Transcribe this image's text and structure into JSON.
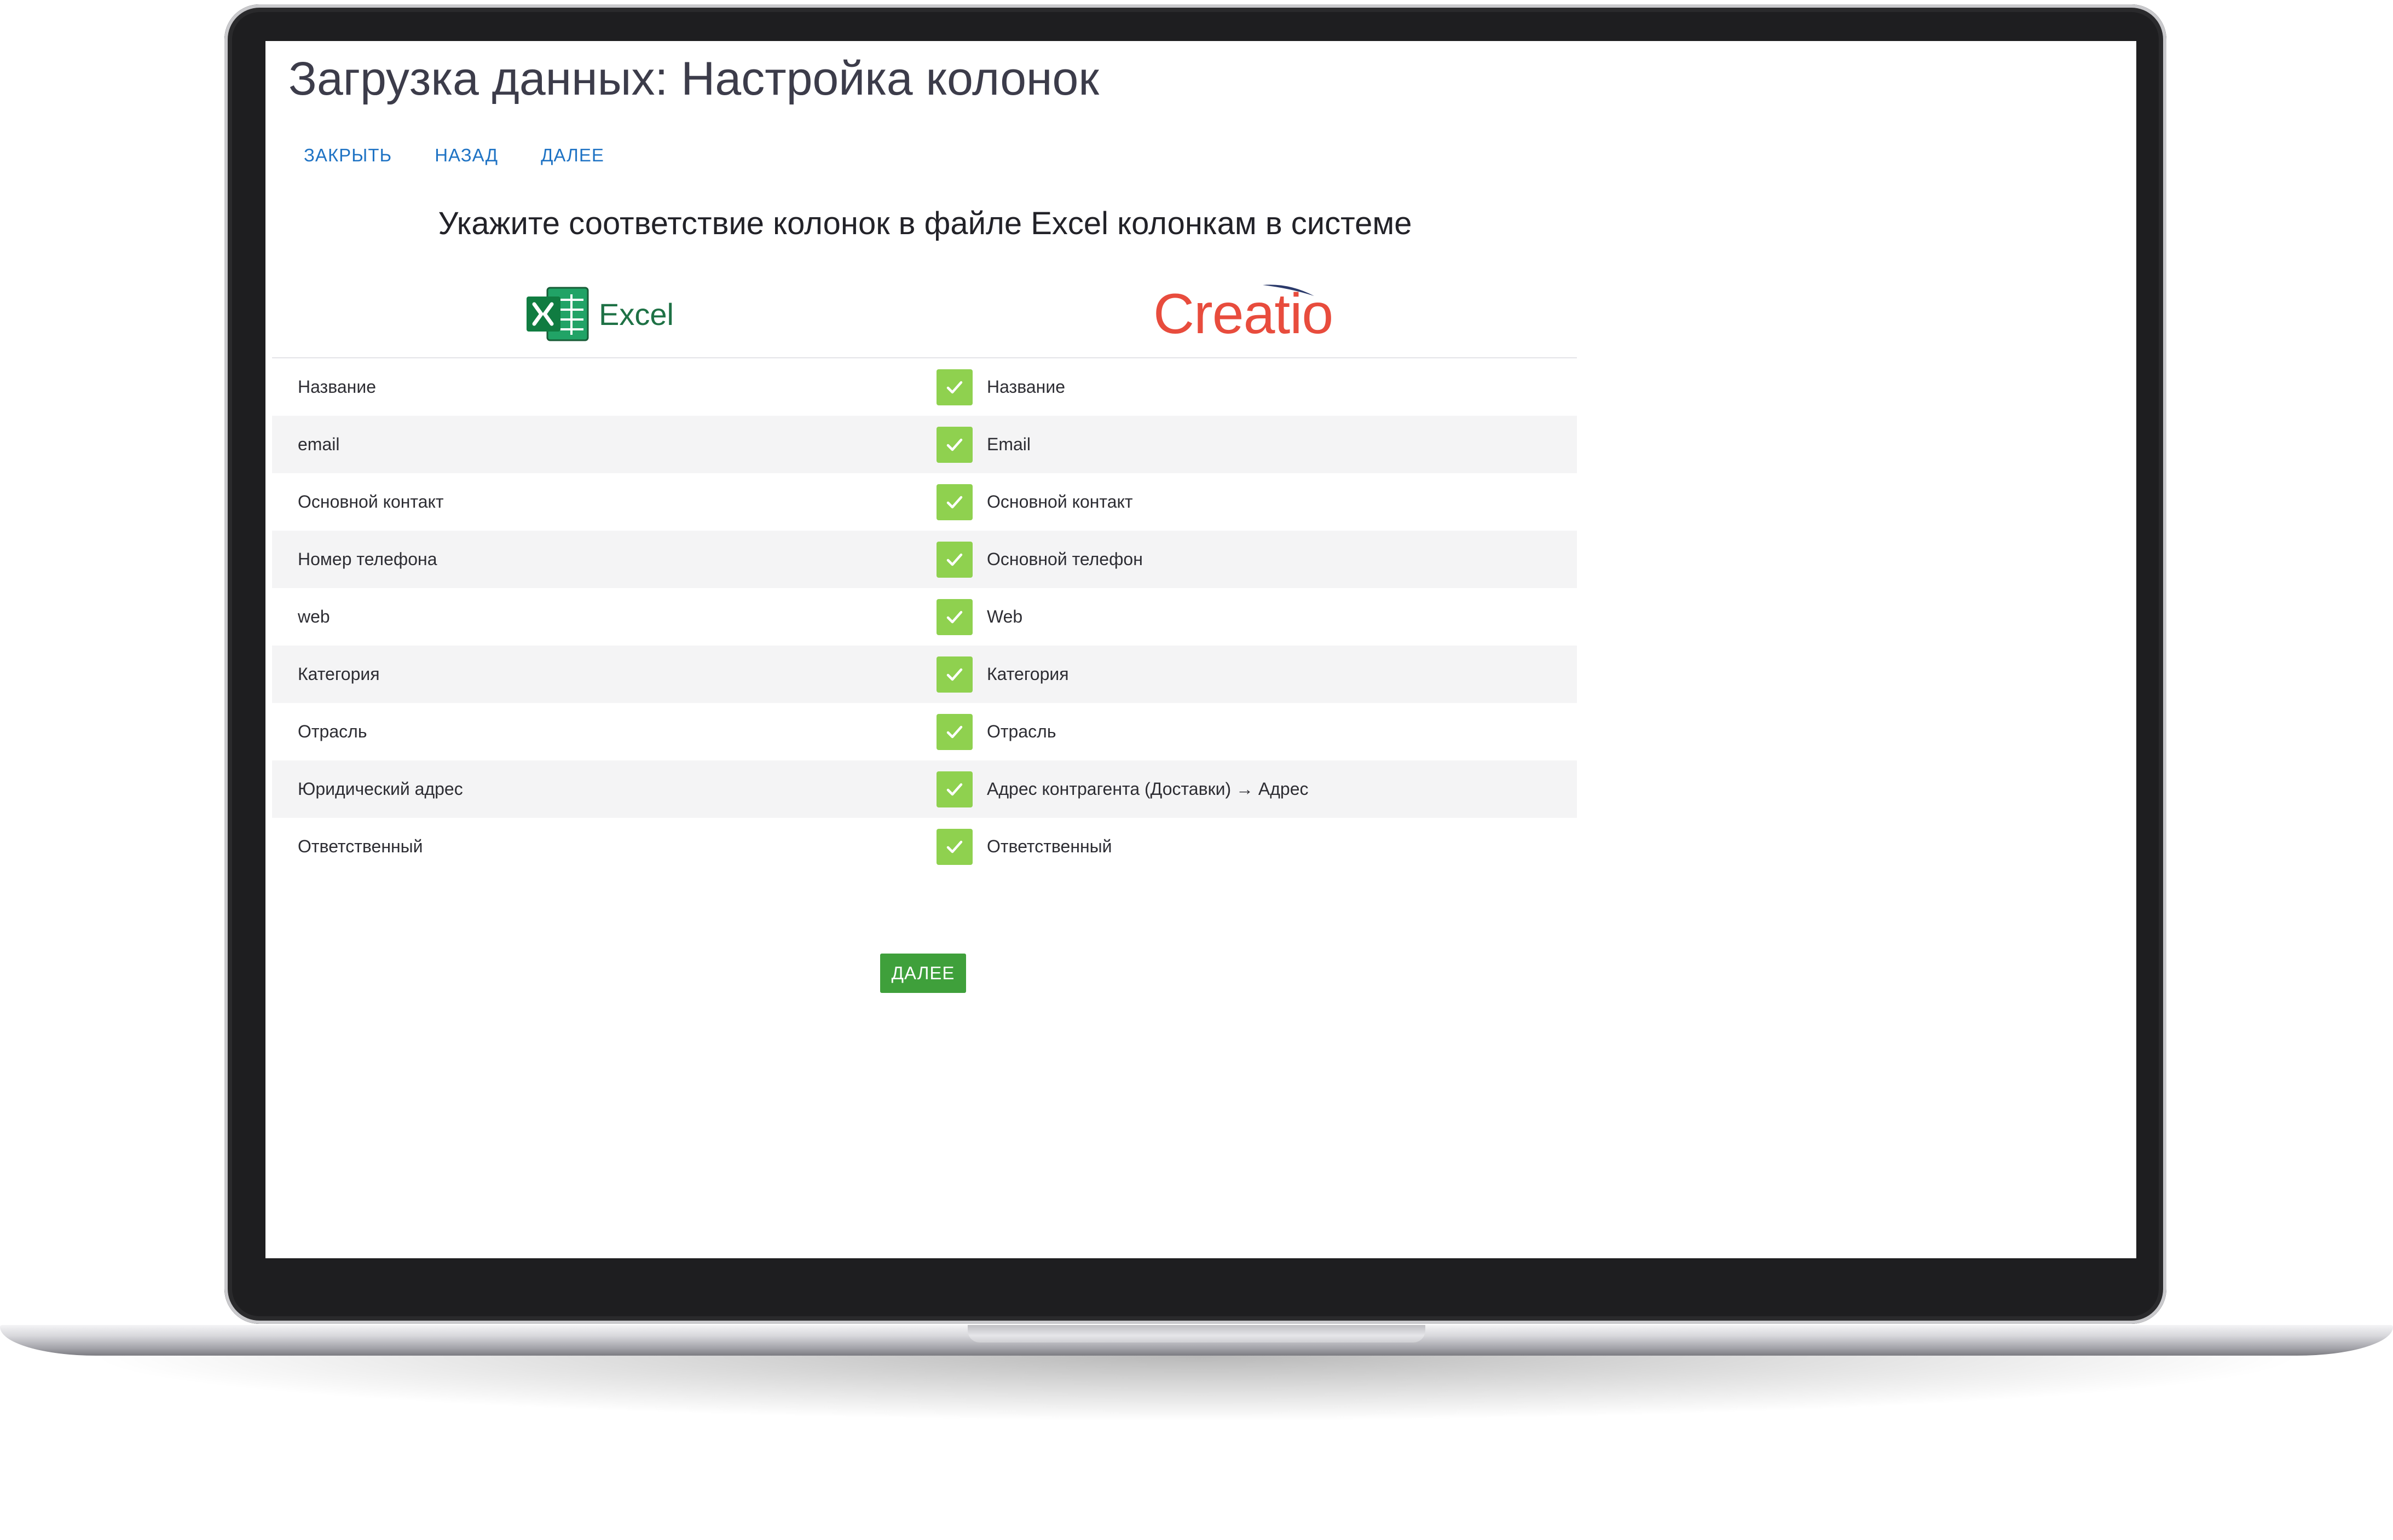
{
  "page": {
    "title": "Загрузка данных: Настройка колонок",
    "toolbar": {
      "close": "ЗАКРЫТЬ",
      "back": "НАЗАД",
      "next": "ДАЛЕЕ"
    },
    "instruction": "Укажите соответствие колонок в файле Excel колонкам в системе",
    "source_logo": {
      "text": "Excel",
      "icon": "excel-logo-icon",
      "color": "#1E7145"
    },
    "target_logo": {
      "text": "Creatio",
      "icon": "creatio-logo",
      "color": "#E84C3D"
    },
    "mappings": [
      {
        "source": "Название",
        "target": "Название"
      },
      {
        "source": "email",
        "target": "Email"
      },
      {
        "source": "Основной контакт",
        "target": "Основной контакт"
      },
      {
        "source": "Номер телефона",
        "target": "Основной телефон"
      },
      {
        "source": "web",
        "target": "Web"
      },
      {
        "source": "Категория",
        "target": "Категория"
      },
      {
        "source": "Отрасль",
        "target": "Отрасль"
      },
      {
        "source": "Юридический адрес",
        "target": "Адрес контрагента (Доставки) → Адрес"
      },
      {
        "source": "Ответственный",
        "target": "Ответственный"
      }
    ],
    "mapping_status_icon": "checkmark-icon",
    "next_button": "ДАЛЕЕ"
  },
  "colors": {
    "link": "#1F73C4",
    "check": "#8FD14F",
    "primary_button": "#3FA03B"
  }
}
